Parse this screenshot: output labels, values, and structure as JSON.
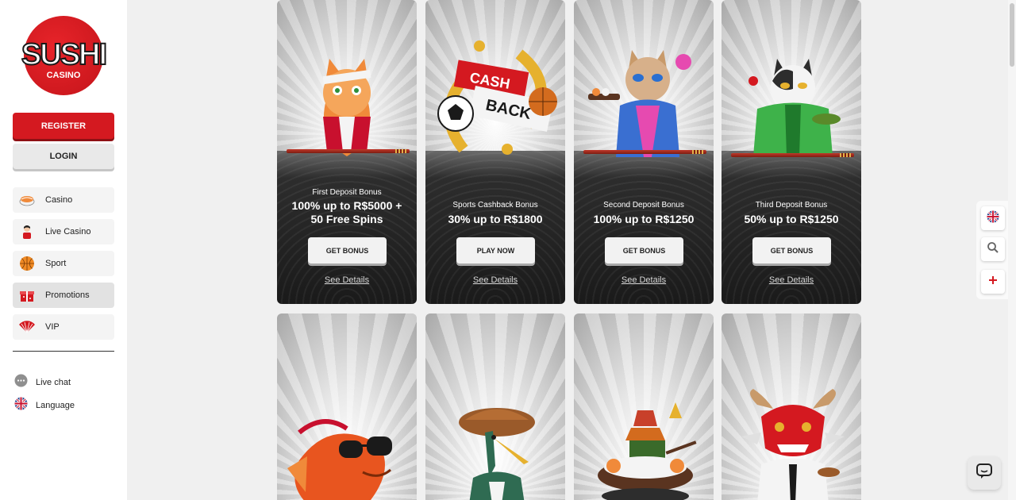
{
  "brand": {
    "name": "SUSHI",
    "sub": "CASINO"
  },
  "sidebar": {
    "register_label": "REGISTER",
    "login_label": "LOGIN",
    "items": [
      {
        "label": "Casino",
        "icon": "sushi-icon"
      },
      {
        "label": "Live Casino",
        "icon": "dealer-icon"
      },
      {
        "label": "Sport",
        "icon": "basketball-icon"
      },
      {
        "label": "Promotions",
        "icon": "gift-icon",
        "active": true
      },
      {
        "label": "VIP",
        "icon": "fan-icon"
      }
    ],
    "utility": [
      {
        "label": "Live chat",
        "icon": "chat-icon"
      },
      {
        "label": "Language",
        "icon": "uk-flag-icon"
      }
    ]
  },
  "promotions": [
    {
      "title": "First Deposit Bonus",
      "offer_line1": "100% up to R$5000 +",
      "offer_line2": "50 Free Spins",
      "button": "GET BONUS",
      "link": "See Details",
      "art": "ninja-cat"
    },
    {
      "title": "Sports Cashback Bonus",
      "offer_line1": "30% up to R$1800",
      "offer_line2": "",
      "button": "PLAY NOW",
      "link": "See Details",
      "art": "cash-back-balls",
      "art_text1": "CASH",
      "art_text2": "BACK"
    },
    {
      "title": "Second Deposit Bonus",
      "offer_line1": "100% up to R$1250",
      "offer_line2": "",
      "button": "GET BONUS",
      "link": "See Details",
      "art": "kimono-cat"
    },
    {
      "title": "Third Deposit Bonus",
      "offer_line1": "50% up to R$1250",
      "offer_line2": "",
      "button": "GET BONUS",
      "link": "See Details",
      "art": "green-cat"
    }
  ],
  "second_row": [
    {
      "art": "goldfish-sunglasses"
    },
    {
      "art": "crane-straw-hat"
    },
    {
      "art": "sushi-pagoda"
    },
    {
      "art": "red-dragon-samurai"
    }
  ],
  "floating": {
    "icons": [
      "uk-flag-icon",
      "search-icon",
      "plus-icon"
    ],
    "chat": "chat-support-icon"
  },
  "colors": {
    "accent": "#d41920",
    "card_dark": "#1a1a1a",
    "sidebar_bg": "#ffffff",
    "page_bg": "#f0f0f0"
  }
}
